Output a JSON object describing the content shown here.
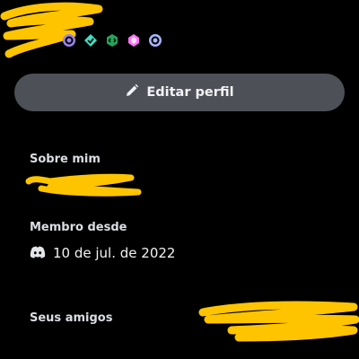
{
  "profile": {
    "badges": [
      {
        "icon": "hypesquad-icon",
        "color": "#9b84ec"
      },
      {
        "icon": "hypesquad-balance-icon",
        "color": "#45ddc0"
      },
      {
        "icon": "active-developer-icon",
        "color": "#23a55a"
      },
      {
        "icon": "nitro-gem-icon",
        "color": "#ff73fa"
      },
      {
        "icon": "quest-icon",
        "color": "#a7b5ff"
      }
    ],
    "edit_label": "Editar perfil"
  },
  "about": {
    "title": "Sobre mim"
  },
  "member_since": {
    "title": "Membro desde",
    "date": "10 de jul. de 2022"
  },
  "friends": {
    "title": "Seus amigos"
  },
  "colors": {
    "background": "#000000",
    "button": "#4e5058",
    "redaction": "#ffc400"
  }
}
